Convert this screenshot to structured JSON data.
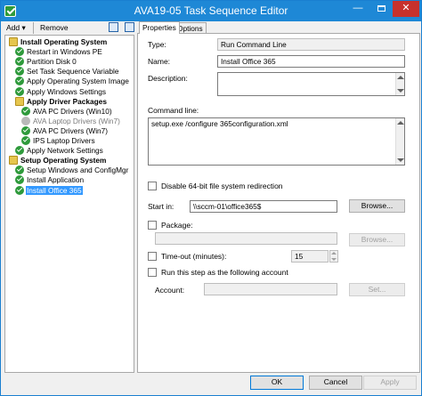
{
  "window": {
    "title": "AVA19-05 Task Sequence Editor",
    "close_glyph": "✕",
    "min_glyph": "—"
  },
  "toolbar": {
    "add_label": "Add",
    "add_arrow": "▾",
    "remove_label": "Remove"
  },
  "tree": [
    {
      "label": "Install Operating System",
      "kind": "group",
      "level": 0
    },
    {
      "label": "Restart in Windows PE",
      "kind": "step",
      "level": 1
    },
    {
      "label": "Partition Disk 0",
      "kind": "step",
      "level": 1
    },
    {
      "label": "Set Task Sequence Variable",
      "kind": "step",
      "level": 1
    },
    {
      "label": "Apply Operating System Image",
      "kind": "step",
      "level": 1
    },
    {
      "label": "Apply Windows Settings",
      "kind": "step",
      "level": 1
    },
    {
      "label": "Apply Driver Packages",
      "kind": "group",
      "level": 1
    },
    {
      "label": "AVA PC Drivers (Win10)",
      "kind": "step",
      "level": 2
    },
    {
      "label": "AVA Laptop Drivers (Win7)",
      "kind": "disabled",
      "level": 2
    },
    {
      "label": "AVA PC Drivers (Win7)",
      "kind": "step",
      "level": 2
    },
    {
      "label": "IPS Laptop Drivers",
      "kind": "step",
      "level": 2
    },
    {
      "label": "Apply Network Settings",
      "kind": "step",
      "level": 1
    },
    {
      "label": "Setup Operating System",
      "kind": "group",
      "level": 0
    },
    {
      "label": "Setup Windows and ConfigMgr",
      "kind": "step",
      "level": 1
    },
    {
      "label": "Install Application",
      "kind": "step",
      "level": 1
    },
    {
      "label": "Install Office 365",
      "kind": "selected",
      "level": 1
    }
  ],
  "tabs": {
    "properties": "Properties",
    "options": "Options"
  },
  "form": {
    "type_label": "Type:",
    "type_value": "Run Command Line",
    "name_label": "Name:",
    "name_value": "Install Office 365",
    "description_label": "Description:",
    "description_value": "",
    "command_line_label": "Command line:",
    "command_line_value": "setup.exe /configure 365configuration.xml",
    "disable_redirect_label": "Disable 64-bit file system redirection",
    "start_in_label": "Start in:",
    "start_in_value": "\\\\sccm-01\\office365$",
    "browse_label": "Browse...",
    "package_label": "Package:",
    "package_value": "",
    "package_browse_label": "Browse...",
    "timeout_label": "Time-out (minutes):",
    "timeout_value": "15",
    "run_as_label": "Run this step as the following account",
    "account_label": "Account:",
    "account_value": "",
    "set_label": "Set..."
  },
  "footer": {
    "ok": "OK",
    "cancel": "Cancel",
    "apply": "Apply"
  }
}
